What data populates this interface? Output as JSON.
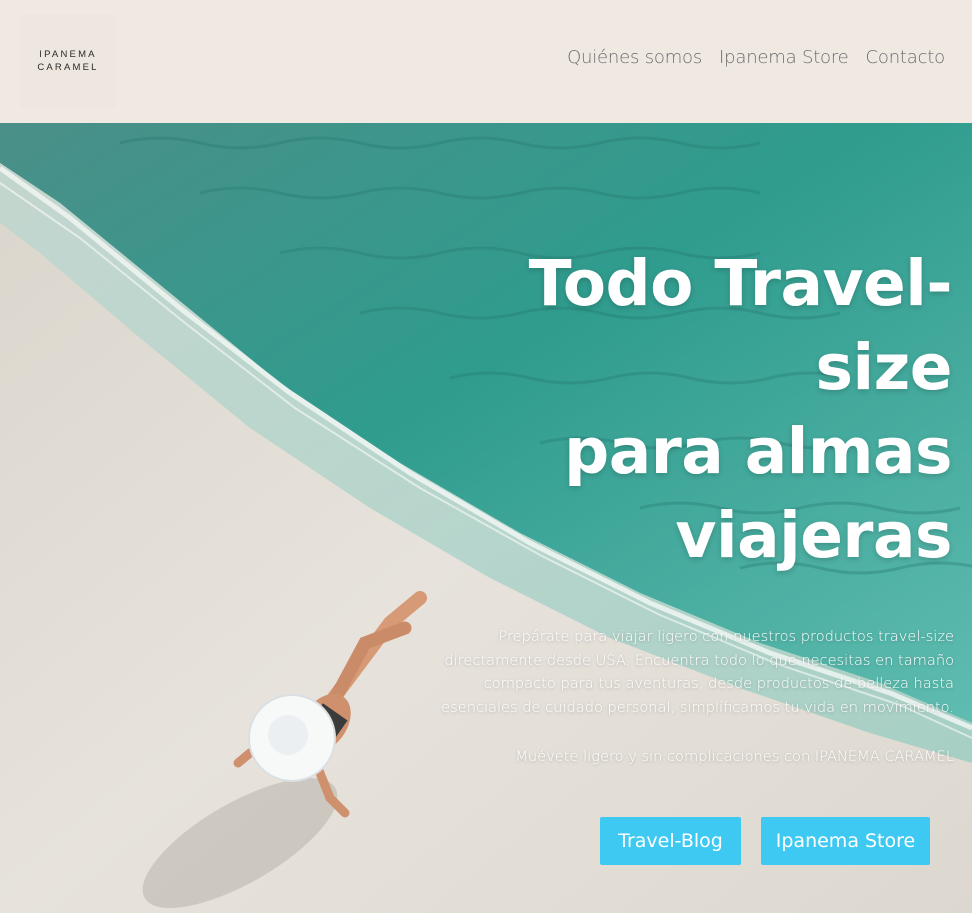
{
  "brand": {
    "line1": "IPANEMA",
    "line2": "CARAMEL"
  },
  "nav": {
    "items": [
      "Quiénes somos",
      "Ipanema Store",
      "Contacto"
    ]
  },
  "hero": {
    "headline_lines": [
      "Todo Travel-",
      "size",
      "para almas",
      "viajeras"
    ],
    "description": "Prepárate para viajar ligero con nuestros productos travel-size directamente desde USA. Encuentra todo lo que necesitas en tamaño compacto para tus aventuras, desde productos de belleza hasta esenciales de cuidado personal, simplificamos tu vida en movimiento.",
    "tagline": "Muévete ligero y sin complicaciones con IPANEMA CARAMEL",
    "buttons": {
      "blog_label": "Travel-Blog",
      "store_label": "Ipanema Store"
    },
    "background_image": "aerial-beach-woman-with-sunhat"
  },
  "colors": {
    "header_bg": "#efe9e2",
    "nav_text": "#6d6d6d",
    "button_bg": "#3ec9f2",
    "sea": "#3fa69a",
    "sand": "#e6e2da"
  }
}
